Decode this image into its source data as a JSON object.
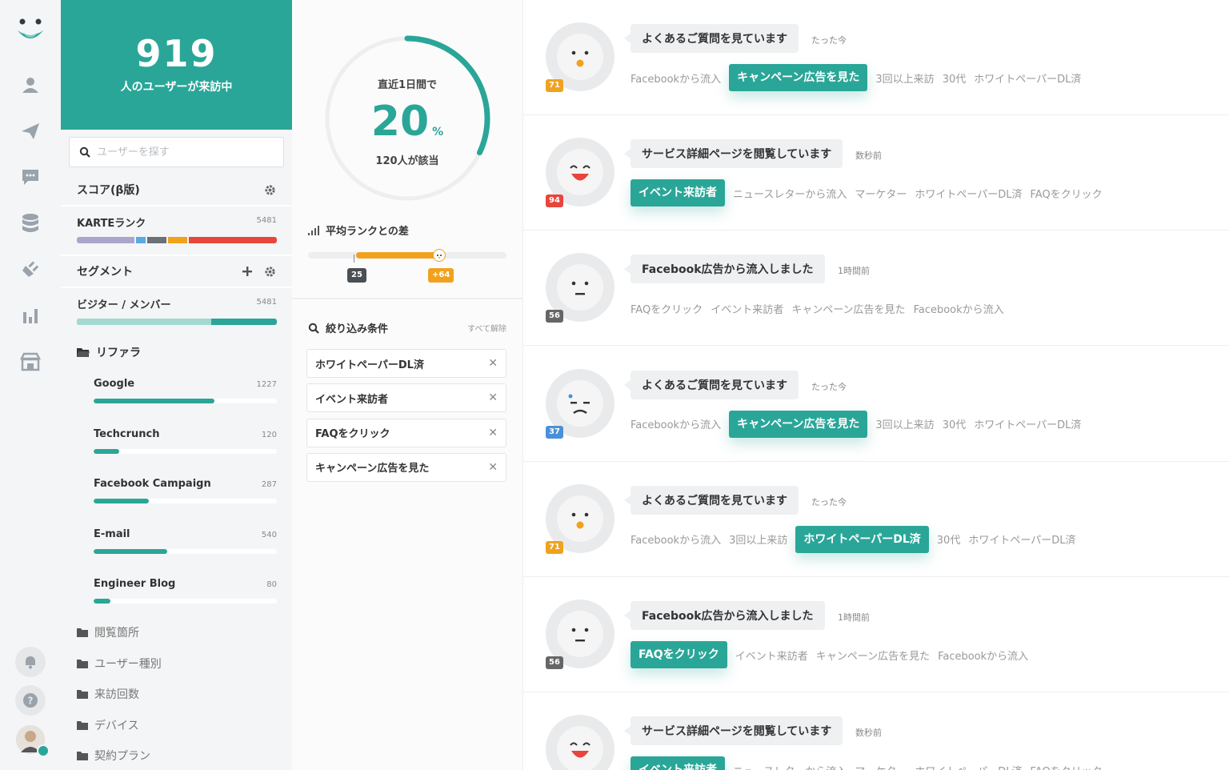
{
  "colors": {
    "accent": "#2aa698",
    "orange": "#f0a21e",
    "red": "#e8453c",
    "blue": "#4a90d9",
    "gray": "#666666"
  },
  "rail": {
    "icons": [
      "logo-icon",
      "user-icon",
      "send-icon",
      "chat-icon",
      "database-icon",
      "plugin-icon",
      "bar-chart-icon",
      "store-icon",
      "bell-icon",
      "help-icon"
    ]
  },
  "segments": {
    "live_count": "919",
    "live_label": "人のユーザーが来訪中",
    "search_placeholder": "ユーザーを探す",
    "score_title": "スコア(β版)",
    "karte_rank": {
      "label": "KARTEランク",
      "value": "5481"
    },
    "segment_title": "セグメント",
    "visitor_member": {
      "label": "ビジター / メンバー",
      "value": "5481",
      "visitor_share": 0.67
    },
    "referrer_folder": "リファラ",
    "referrers": [
      {
        "name": "Google",
        "count": "1227",
        "fill": 0.66
      },
      {
        "name": "Techcrunch",
        "count": "120",
        "fill": 0.14
      },
      {
        "name": "Facebook Campaign",
        "count": "287",
        "fill": 0.3
      },
      {
        "name": "E-mail",
        "count": "540",
        "fill": 0.4
      },
      {
        "name": "Engineer Blog",
        "count": "80",
        "fill": 0.09
      }
    ],
    "folders": [
      "閲覧箇所",
      "ユーザー種別",
      "来訪回数",
      "デバイス",
      "契約プラン"
    ]
  },
  "summary": {
    "period": "直近1日間で",
    "percent": "20",
    "percent_unit": "%",
    "matched": "120人が該当",
    "percent_value": 0.2,
    "avg_rank_title": "平均ランクとの差",
    "avg_badge": "25",
    "diff_badge": "+64",
    "filter_title": "絞り込み条件",
    "clear_all": "すべて解除",
    "filters": [
      "ホワイトペーパーDL済",
      "イベント来訪者",
      "FAQをクリック",
      "キャンペーン広告を見た"
    ]
  },
  "feed": [
    {
      "score": "71",
      "score_color": "#f0a21e",
      "face": "surprised",
      "action": "よくあるご質問を見ています",
      "time": "たった今",
      "tags": [
        {
          "t": "Facebookから流入",
          "hl": false
        },
        {
          "t": "キャンペーン広告を見た",
          "hl": true
        },
        {
          "t": "3回以上来訪",
          "hl": false
        },
        {
          "t": "30代",
          "hl": false
        },
        {
          "t": "ホワイトペーパーDL済",
          "hl": false
        }
      ]
    },
    {
      "score": "94",
      "score_color": "#e8453c",
      "face": "happy",
      "action": "サービス詳細ページを閲覧しています",
      "time": "数秒前",
      "tags": [
        {
          "t": "イベント来訪者",
          "hl": true
        },
        {
          "t": "ニュースレターから流入",
          "hl": false
        },
        {
          "t": "マーケター",
          "hl": false
        },
        {
          "t": "ホワイトペーパーDL済",
          "hl": false
        },
        {
          "t": "FAQをクリック",
          "hl": false
        }
      ]
    },
    {
      "score": "56",
      "score_color": "#666666",
      "face": "neutral",
      "action": "Facebook広告から流入しました",
      "time": "1時間前",
      "tags": [
        {
          "t": "FAQをクリック",
          "hl": false
        },
        {
          "t": "イベント来訪者",
          "hl": false
        },
        {
          "t": "キャンペーン広告を見た",
          "hl": false
        },
        {
          "t": "Facebookから流入",
          "hl": false
        }
      ]
    },
    {
      "score": "37",
      "score_color": "#4a90d9",
      "face": "sad",
      "action": "よくあるご質問を見ています",
      "time": "たった今",
      "tags": [
        {
          "t": "Facebookから流入",
          "hl": false
        },
        {
          "t": "キャンペーン広告を見た",
          "hl": true
        },
        {
          "t": "3回以上来訪",
          "hl": false
        },
        {
          "t": "30代",
          "hl": false
        },
        {
          "t": "ホワイトペーパーDL済",
          "hl": false
        }
      ]
    },
    {
      "score": "71",
      "score_color": "#f0a21e",
      "face": "surprised",
      "action": "よくあるご質問を見ています",
      "time": "たった今",
      "tags": [
        {
          "t": "Facebookから流入",
          "hl": false
        },
        {
          "t": "3回以上来訪",
          "hl": false
        },
        {
          "t": "ホワイトペーパーDL済",
          "hl": true
        },
        {
          "t": "30代",
          "hl": false
        },
        {
          "t": "ホワイトペーパーDL済",
          "hl": false
        }
      ]
    },
    {
      "score": "56",
      "score_color": "#666666",
      "face": "neutral",
      "action": "Facebook広告から流入しました",
      "time": "1時間前",
      "tags": [
        {
          "t": "FAQをクリック",
          "hl": true
        },
        {
          "t": "イベント来訪者",
          "hl": false
        },
        {
          "t": "キャンペーン広告を見た",
          "hl": false
        },
        {
          "t": "Facebookから流入",
          "hl": false
        }
      ]
    },
    {
      "score": "",
      "score_color": "#e8453c",
      "face": "happy",
      "action": "サービス詳細ページを閲覧しています",
      "time": "数秒前",
      "tags": [
        {
          "t": "イベント来訪者",
          "hl": true
        },
        {
          "t": "ニュースレターから流入",
          "hl": false
        },
        {
          "t": "マーケター",
          "hl": false
        },
        {
          "t": "ホワイトペーパーDL済",
          "hl": false
        },
        {
          "t": "FAQをクリック",
          "hl": false
        }
      ]
    }
  ]
}
